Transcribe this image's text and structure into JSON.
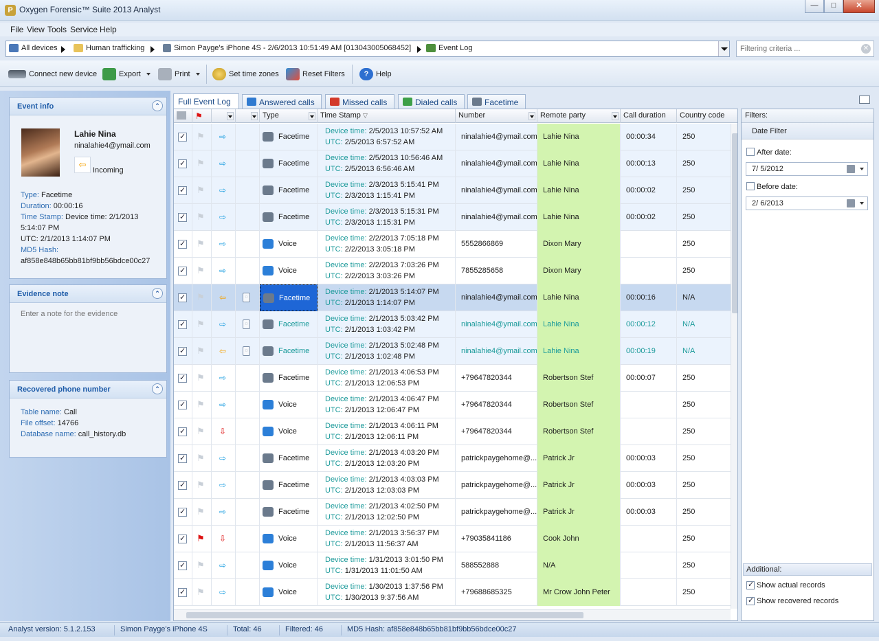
{
  "window": {
    "title": "Oxygen Forensic™ Suite 2013 Analyst",
    "app_icon_letter": "P"
  },
  "menu": [
    "File",
    "View",
    "Tools",
    "Service",
    "Help"
  ],
  "breadcrumb": {
    "items": [
      "All devices",
      "Human trafficking",
      "Simon Payge's iPhone 4S - 2/6/2013 10:51:49 AM [013043005068452]",
      "Event Log"
    ]
  },
  "filter": {
    "placeholder": "Filtering criteria ..."
  },
  "toolbar": {
    "connect": "Connect new device",
    "export": "Export",
    "print": "Print",
    "time_zones": "Set time zones",
    "reset_filters": "Reset Filters",
    "help": "Help"
  },
  "event_info": {
    "heading": "Event info",
    "name": "Lahie Nina",
    "email": "ninalahie4@ymail.com",
    "direction": "Incoming",
    "type_label": "Type:",
    "type_value": "Facetime",
    "duration_label": "Duration:",
    "duration_value": "00:00:16",
    "timestamp_label": "Time Stamp:",
    "timestamp_value": "Device time: 2/1/2013",
    "timestamp_line2": "5:14:07 PM",
    "utc_line": "UTC: 2/1/2013 1:14:07 PM",
    "md5_label": "MD5 Hash:",
    "md5_value": "af858e848b65bb81bf9bb56bdce00c27"
  },
  "evidence_note": {
    "heading": "Evidence note",
    "placeholder": "Enter a note for the evidence"
  },
  "recovered": {
    "heading": "Recovered phone number",
    "table_label": "Table name:",
    "table_value": "Call",
    "offset_label": "File offset:",
    "offset_value": "14766",
    "db_label": "Database name:",
    "db_value": "call_history.db"
  },
  "tabs": [
    "Full Event Log",
    "Answered calls",
    "Missed calls",
    "Dialed calls",
    "Facetime"
  ],
  "columns": [
    "Type",
    "Time Stamp",
    "Number",
    "Remote party",
    "Call duration",
    "Country code"
  ],
  "rows": [
    {
      "dir": "out",
      "del": false,
      "flag": false,
      "type": "Facetime",
      "dev": "2/5/2013 10:57:52 AM",
      "utc": "2/5/2013 6:57:52 AM",
      "number": "ninalahie4@ymail.com",
      "party": "Lahie Nina",
      "dur": "00:00:34",
      "cc": "250",
      "style": "blue"
    },
    {
      "dir": "out",
      "del": false,
      "flag": false,
      "type": "Facetime",
      "dev": "2/5/2013 10:56:46 AM",
      "utc": "2/5/2013 6:56:46 AM",
      "number": "ninalahie4@ymail.com",
      "party": "Lahie Nina",
      "dur": "00:00:13",
      "cc": "250",
      "style": "blue"
    },
    {
      "dir": "out",
      "del": false,
      "flag": false,
      "type": "Facetime",
      "dev": "2/3/2013 5:15:41 PM",
      "utc": "2/3/2013 1:15:41 PM",
      "number": "ninalahie4@ymail.com",
      "party": "Lahie Nina",
      "dur": "00:00:02",
      "cc": "250",
      "style": "blue"
    },
    {
      "dir": "out",
      "del": false,
      "flag": false,
      "type": "Facetime",
      "dev": "2/3/2013 5:15:31 PM",
      "utc": "2/3/2013 1:15:31 PM",
      "number": "ninalahie4@ymail.com",
      "party": "Lahie Nina",
      "dur": "00:00:02",
      "cc": "250",
      "style": "blue"
    },
    {
      "dir": "out",
      "del": false,
      "flag": false,
      "type": "Voice",
      "dev": "2/2/2013 7:05:18 PM",
      "utc": "2/2/2013 3:05:18 PM",
      "number": "5552866869",
      "party": "Dixon Mary",
      "dur": "",
      "cc": "250",
      "style": "white"
    },
    {
      "dir": "out",
      "del": false,
      "flag": false,
      "type": "Voice",
      "dev": "2/2/2013 7:03:26 PM",
      "utc": "2/2/2013 3:03:26 PM",
      "number": "7855285658",
      "party": "Dixon Mary",
      "dur": "",
      "cc": "250",
      "style": "white"
    },
    {
      "dir": "in",
      "del": true,
      "flag": false,
      "type": "Facetime",
      "dev": "2/1/2013 5:14:07 PM",
      "utc": "2/1/2013 1:14:07 PM",
      "number": "ninalahie4@ymail.com",
      "party": "Lahie Nina",
      "dur": "00:00:16",
      "cc": "N/A",
      "style": "sel"
    },
    {
      "dir": "out",
      "del": true,
      "flag": false,
      "type": "Facetime",
      "dev": "2/1/2013 5:03:42 PM",
      "utc": "2/1/2013 1:03:42 PM",
      "number": "ninalahie4@ymail.com",
      "party": "Lahie Nina",
      "dur": "00:00:12",
      "cc": "N/A",
      "style": "teal"
    },
    {
      "dir": "in",
      "del": true,
      "flag": false,
      "type": "Facetime",
      "dev": "2/1/2013 5:02:48 PM",
      "utc": "2/1/2013 1:02:48 PM",
      "number": "ninalahie4@ymail.com",
      "party": "Lahie Nina",
      "dur": "00:00:19",
      "cc": "N/A",
      "style": "teal"
    },
    {
      "dir": "out",
      "del": false,
      "flag": false,
      "type": "Facetime",
      "dev": "2/1/2013 4:06:53 PM",
      "utc": "2/1/2013 12:06:53 PM",
      "number": "+79647820344",
      "party": "Robertson Stef",
      "dur": "00:00:07",
      "cc": "250",
      "style": "white"
    },
    {
      "dir": "out",
      "del": false,
      "flag": false,
      "type": "Voice",
      "dev": "2/1/2013 4:06:47 PM",
      "utc": "2/1/2013 12:06:47 PM",
      "number": "+79647820344",
      "party": "Robertson Stef",
      "dur": "",
      "cc": "250",
      "style": "white"
    },
    {
      "dir": "miss",
      "del": false,
      "flag": false,
      "type": "Voice",
      "dev": "2/1/2013 4:06:11 PM",
      "utc": "2/1/2013 12:06:11 PM",
      "number": "+79647820344",
      "party": "Robertson Stef",
      "dur": "",
      "cc": "250",
      "style": "white"
    },
    {
      "dir": "out",
      "del": false,
      "flag": false,
      "type": "Facetime",
      "dev": "2/1/2013 4:03:20 PM",
      "utc": "2/1/2013 12:03:20 PM",
      "number": "patrickpaygehome@...",
      "party": "Patrick Jr",
      "dur": "00:00:03",
      "cc": "250",
      "style": "white"
    },
    {
      "dir": "out",
      "del": false,
      "flag": false,
      "type": "Facetime",
      "dev": "2/1/2013 4:03:03 PM",
      "utc": "2/1/2013 12:03:03 PM",
      "number": "patrickpaygehome@...",
      "party": "Patrick Jr",
      "dur": "00:00:03",
      "cc": "250",
      "style": "white"
    },
    {
      "dir": "out",
      "del": false,
      "flag": false,
      "type": "Facetime",
      "dev": "2/1/2013 4:02:50 PM",
      "utc": "2/1/2013 12:02:50 PM",
      "number": "patrickpaygehome@...",
      "party": "Patrick Jr",
      "dur": "00:00:03",
      "cc": "250",
      "style": "white"
    },
    {
      "dir": "miss",
      "del": false,
      "flag": true,
      "type": "Voice",
      "dev": "2/1/2013 3:56:37 PM",
      "utc": "2/1/2013 11:56:37 AM",
      "number": "+79035841186",
      "party": "Cook John",
      "dur": "",
      "cc": "250",
      "style": "white"
    },
    {
      "dir": "out",
      "del": false,
      "flag": false,
      "type": "Voice",
      "dev": "1/31/2013 3:01:50 PM",
      "utc": "1/31/2013 11:01:50 AM",
      "number": "588552888",
      "party": "N/A",
      "dur": "",
      "cc": "250",
      "style": "white"
    },
    {
      "dir": "out",
      "del": false,
      "flag": false,
      "type": "Voice",
      "dev": "1/30/2013 1:37:56 PM",
      "utc": "1/30/2013 9:37:56 AM",
      "number": "+79688685325",
      "party": "Mr Crow John Peter",
      "dur": "",
      "cc": "250",
      "style": "white"
    }
  ],
  "labels": {
    "device_time": "Device time:",
    "utc": "UTC:"
  },
  "filters_panel": {
    "heading": "Filters:",
    "date_filter": "Date Filter",
    "after_label": "After date:",
    "after_value": "7/  5/2012",
    "before_label": "Before date:",
    "before_value": "2/  6/2013",
    "additional": "Additional:",
    "show_actual": "Show actual records",
    "show_recovered": "Show recovered records"
  },
  "status": {
    "version": "Analyst version: 5.1.2.153",
    "device": "Simon Payge's iPhone 4S",
    "total": "Total: 46",
    "filtered": "Filtered: 46",
    "md5": "MD5 Hash: af858e848b65bb81bf9bb56bdce00c27"
  },
  "colors": {
    "accent": "#1d5ba8",
    "remote_party_bg": "#d3f4b0",
    "recovered_text": "#1a9a9a"
  }
}
